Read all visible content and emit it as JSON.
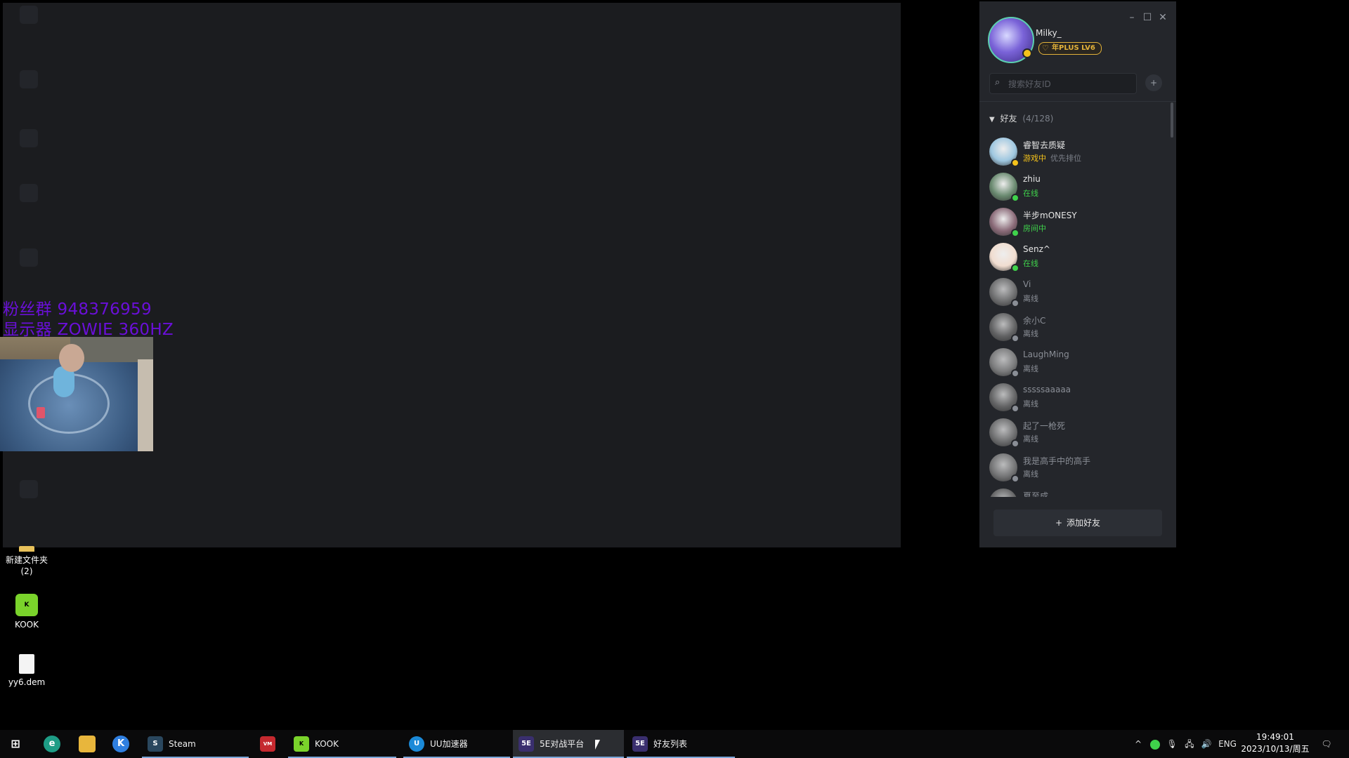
{
  "overlay": {
    "line1": "粉丝群 948376959",
    "line2": "显示器 ZOWIE 360HZ"
  },
  "desktop_icons": [
    {
      "label": "新建文件夹\n(2)",
      "icon": "folder-icon"
    },
    {
      "label": "KOOK",
      "icon": "kook-icon"
    },
    {
      "label": "yy6.dem",
      "icon": "file-icon"
    }
  ],
  "friend_window": {
    "username": "Milky_",
    "badge": "年PLUS LV6",
    "search": {
      "placeholder": "搜索好友ID"
    },
    "group": {
      "label": "好友",
      "count": "(4/128)"
    },
    "friends": [
      {
        "name": "睿智去质疑",
        "status": "游戏中",
        "sub": "优先排位",
        "state": "gaming"
      },
      {
        "name": "zhiu",
        "status": "在线",
        "sub": "",
        "state": "online"
      },
      {
        "name": "半步mONESY",
        "status": "房间中",
        "sub": "",
        "state": "online"
      },
      {
        "name": "Senz^",
        "status": "在线",
        "sub": "",
        "state": "online"
      },
      {
        "name": "Vi",
        "status": "离线",
        "sub": "",
        "state": "offline"
      },
      {
        "name": "余小C",
        "status": "离线",
        "sub": "",
        "state": "offline"
      },
      {
        "name": "LaughMing",
        "status": "离线",
        "sub": "",
        "state": "offline"
      },
      {
        "name": "sssssaaaaa",
        "status": "离线",
        "sub": "",
        "state": "offline"
      },
      {
        "name": "起了一枪死",
        "status": "离线",
        "sub": "",
        "state": "offline"
      },
      {
        "name": "我是高手中的高手",
        "status": "离线",
        "sub": "",
        "state": "offline"
      },
      {
        "name": "夏至成",
        "status": "",
        "sub": "",
        "state": "offline"
      }
    ],
    "add_friend_label": "添加好友",
    "colors": {
      "gaming": "#f4c21b",
      "online": "#3fd24b",
      "offline": "#8a8e96"
    }
  },
  "taskbar": {
    "apps": [
      {
        "label": "Steam",
        "icon": "steam-icon"
      },
      {
        "label": "",
        "icon": "voicemeeter-icon"
      },
      {
        "label": "KOOK",
        "icon": "kook-icon"
      },
      {
        "label": "UU加速器",
        "icon": "uu-icon"
      },
      {
        "label": "5E对战平台",
        "icon": "5e-icon"
      },
      {
        "label": "好友列表",
        "icon": "5e-icon"
      }
    ],
    "tray": {
      "language": "ENG",
      "time": "19:49:01",
      "date": "2023/10/13/周五"
    }
  }
}
